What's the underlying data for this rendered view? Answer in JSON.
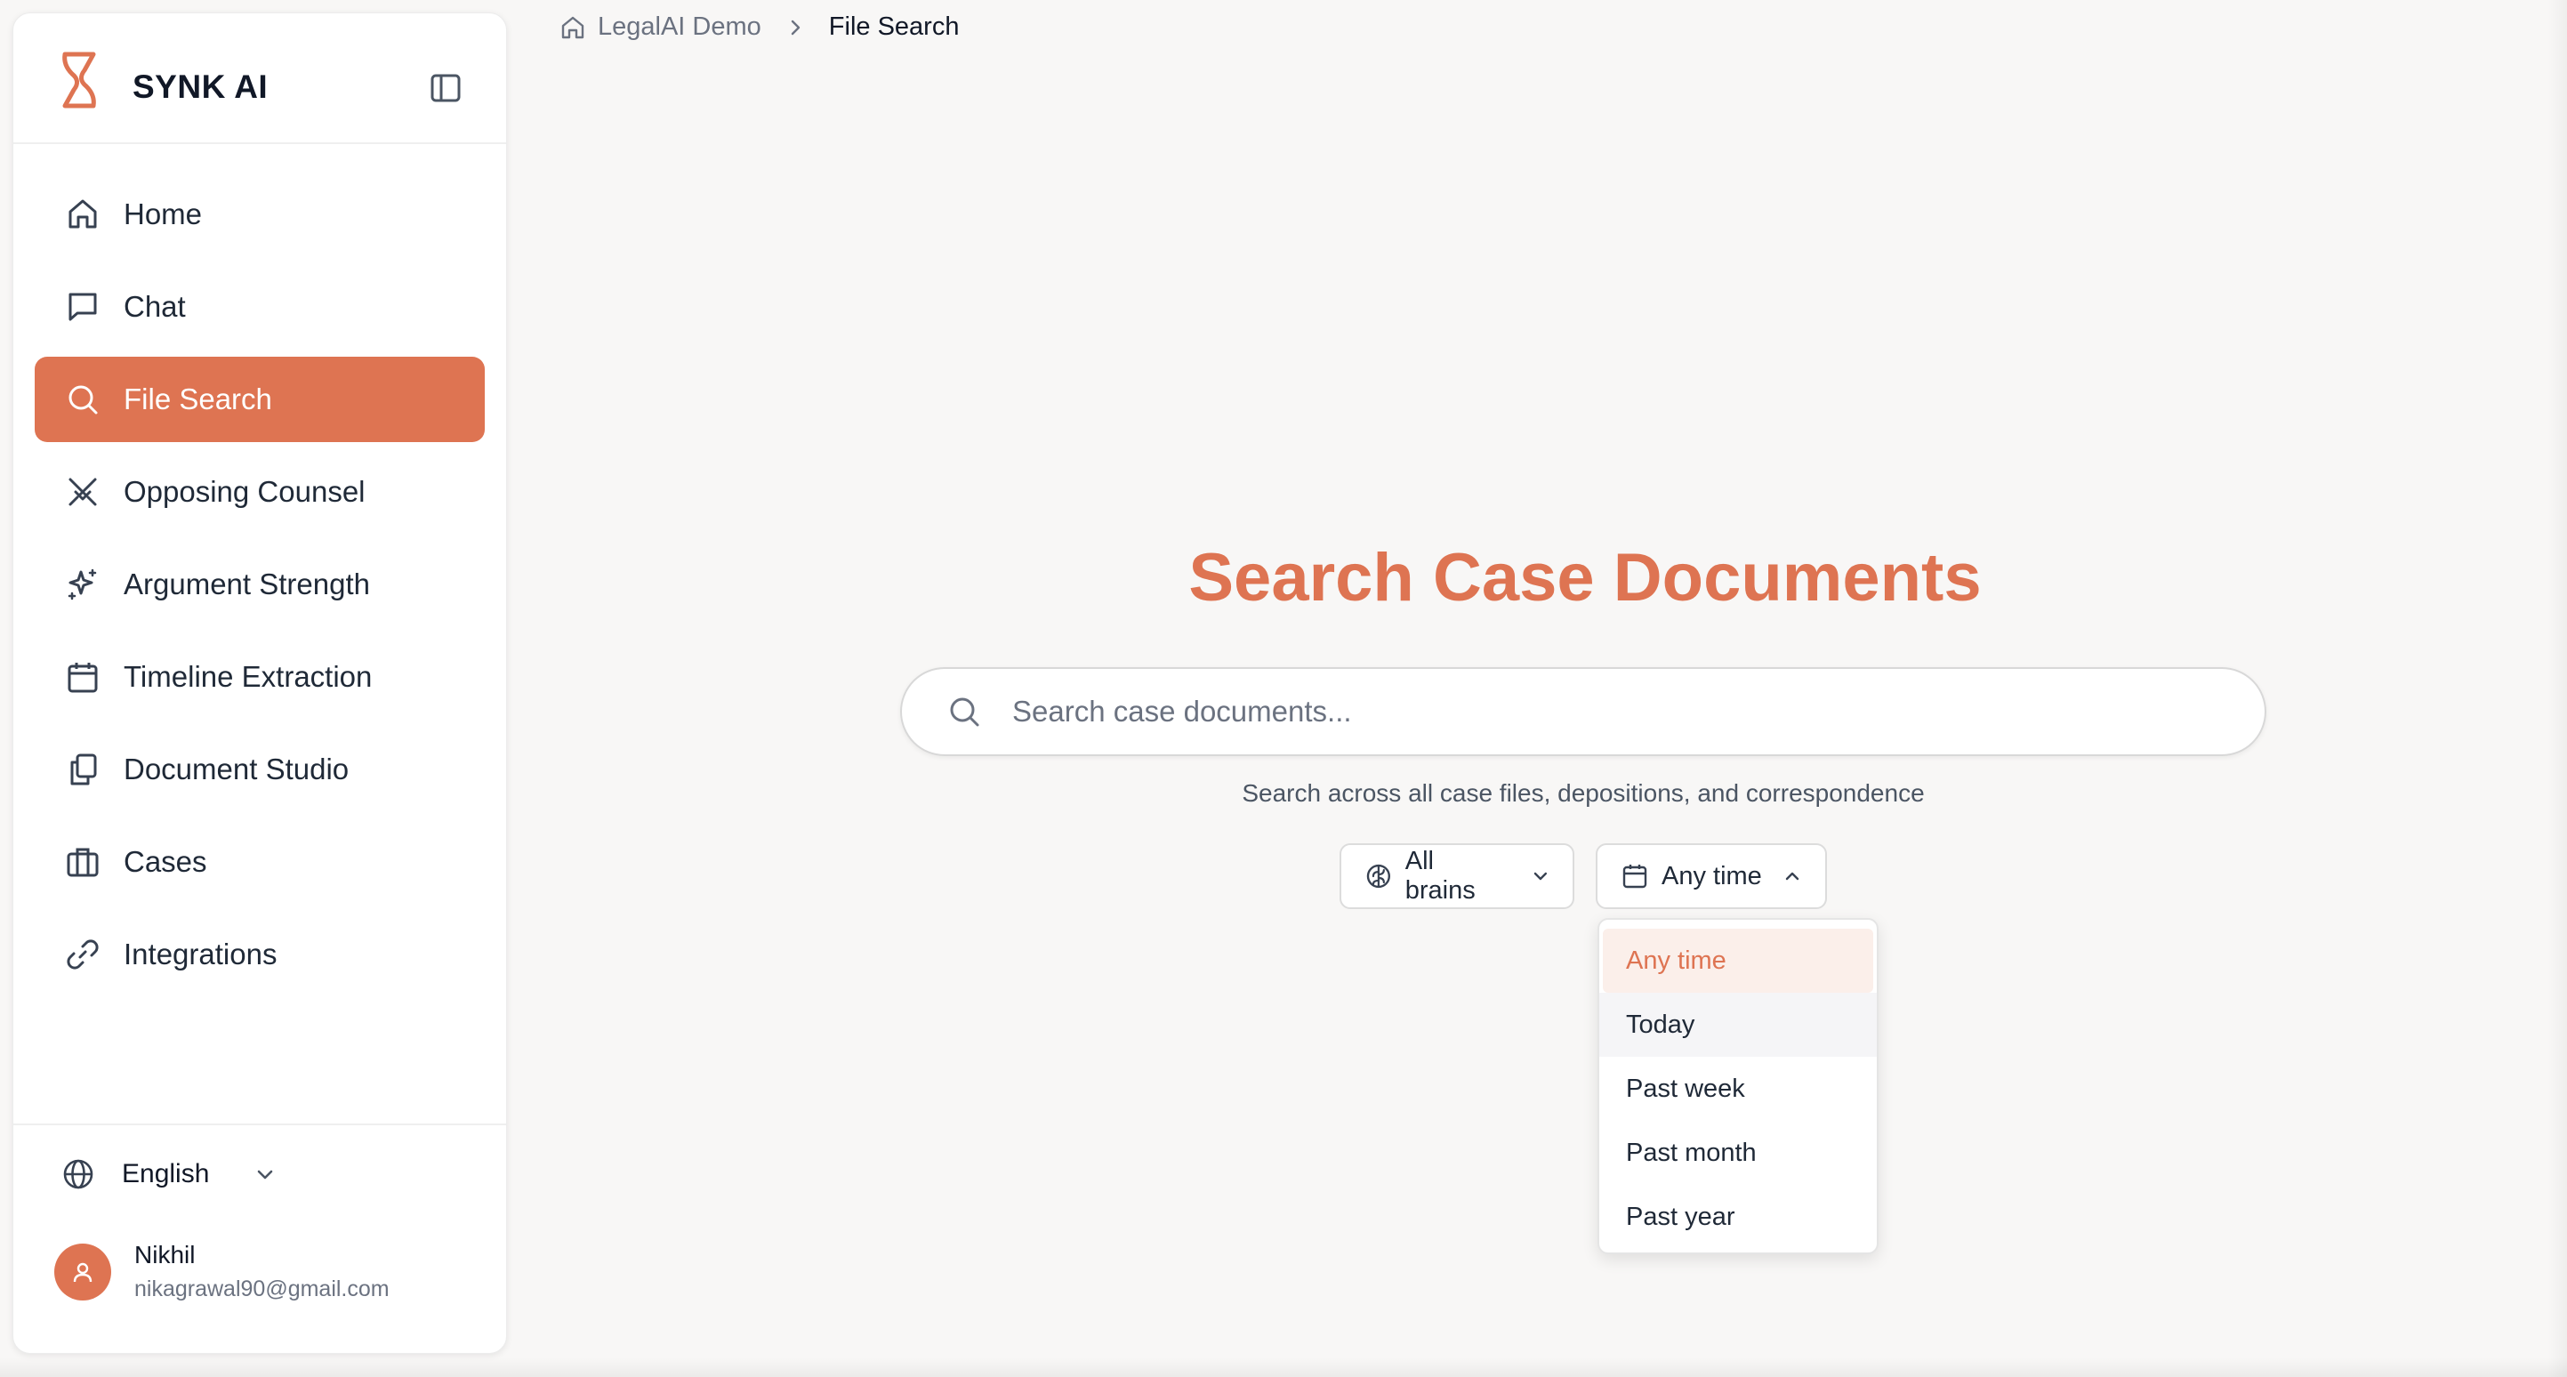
{
  "brand": {
    "name": "SYNK AI",
    "accent_color": "#de7452",
    "logo_icon": "hourglass-s-icon"
  },
  "sidebar": {
    "items": [
      {
        "label": "Home",
        "icon": "home-icon",
        "active": false
      },
      {
        "label": "Chat",
        "icon": "chat-icon",
        "active": false
      },
      {
        "label": "File Search",
        "icon": "search-icon",
        "active": true
      },
      {
        "label": "Opposing Counsel",
        "icon": "swords-icon",
        "active": false
      },
      {
        "label": "Argument Strength",
        "icon": "sparkles-icon",
        "active": false
      },
      {
        "label": "Timeline Extraction",
        "icon": "calendar-icon",
        "active": false
      },
      {
        "label": "Document Studio",
        "icon": "documents-icon",
        "active": false
      },
      {
        "label": "Cases",
        "icon": "briefcase-icon",
        "active": false
      },
      {
        "label": "Integrations",
        "icon": "link-icon",
        "active": false
      }
    ],
    "language": "English",
    "user": {
      "name": "Nikhil",
      "email": "nikagrawal90@gmail.com"
    }
  },
  "breadcrumb": {
    "parent": "LegalAI Demo",
    "current": "File Search"
  },
  "main": {
    "title": "Search Case Documents",
    "search_placeholder": "Search case documents...",
    "search_value": "",
    "helper_text": "Search across all case files, depositions, and correspondence",
    "filters": {
      "brains_label": "All brains",
      "time_label": "Any time"
    },
    "time_dropdown": {
      "open": true,
      "selected": "Any time",
      "options": [
        "Any time",
        "Today",
        "Past week",
        "Past month",
        "Past year"
      ]
    }
  }
}
